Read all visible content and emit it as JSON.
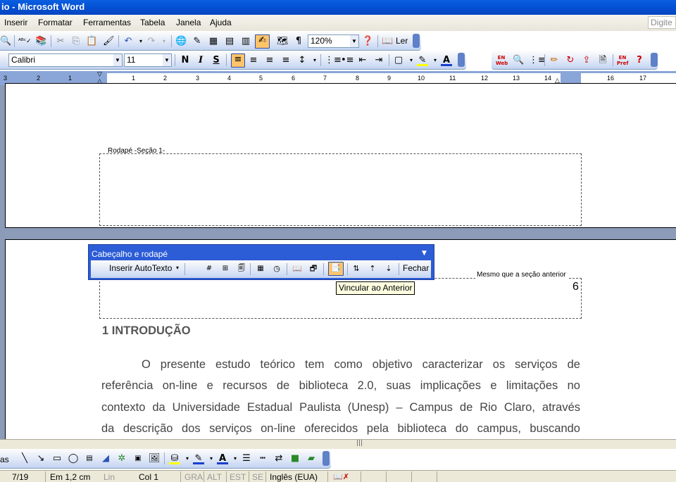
{
  "window": {
    "title": "io - Microsoft Word"
  },
  "menubar": {
    "items": [
      "Inserir",
      "Formatar",
      "Ferramentas",
      "Tabela",
      "Janela",
      "Ajuda"
    ],
    "help_placeholder": "Digite"
  },
  "standard_toolbar": {
    "zoom": "120%",
    "read_label": "Ler"
  },
  "formatting_toolbar": {
    "font": "Calibri",
    "size": "11",
    "bold": "N",
    "italic": "I",
    "underline": "S"
  },
  "extra_toolbar": {
    "en_web": "EN Web",
    "en_pref": "EN Pref"
  },
  "ruler": {
    "numbers": [
      "3",
      "2",
      "1",
      "1",
      "2",
      "3",
      "4",
      "5",
      "6",
      "7",
      "8",
      "9",
      "10",
      "11",
      "12",
      "13",
      "14",
      "16",
      "17"
    ]
  },
  "page1": {
    "footer_label": "Rodapé -Seção 1-"
  },
  "header_footer_toolbar": {
    "title": "Cabeçalho e rodapé",
    "insert_autotext": "Inserir AutoTexto",
    "close": "Fechar",
    "tooltip": "Vincular ao Anterior"
  },
  "page2": {
    "header_link_label": "Mesmo que a seção anterior",
    "page_number": "6",
    "heading": "1 INTRODUÇÃO",
    "paragraph_lines": [
      "O presente estudo teórico tem como objetivo caracterizar os serviços de",
      "referência on-line e recursos de biblioteca 2.0, suas implicações e limitações no",
      "contexto da Universidade Estadual Paulista (Unesp) – Campus de Rio Claro, através",
      "da descrição dos serviços on-line oferecidos pela biblioteca do campus, buscando"
    ]
  },
  "drawing_toolbar": {
    "label": "as"
  },
  "statusbar": {
    "page": "7/19",
    "position": "Em 1,2 cm",
    "line": "Lin",
    "col": "Col 1",
    "rec": "GRA",
    "trk": "ALT",
    "ext": "EST",
    "ovr": "SE",
    "language": "Inglês (EUA)"
  }
}
